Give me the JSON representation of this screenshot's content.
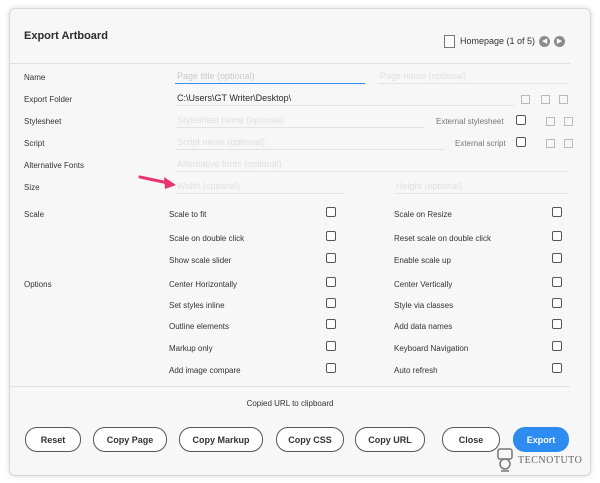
{
  "dialog": {
    "title": "Export Artboard",
    "page_nav": {
      "label": "Homepage (1 of 5)",
      "prev_icon": "chevron-left-icon",
      "next_icon": "chevron-right-icon"
    }
  },
  "fields": {
    "name": {
      "label": "Name",
      "placeholder": "Page title (optional)",
      "secondary_placeholder": "Page name (optional)"
    },
    "export_folder": {
      "label": "Export Folder",
      "value": "C:\\Users\\GT Writer\\Desktop\\"
    },
    "stylesheet": {
      "label": "Stylesheet",
      "placeholder": "Stylesheet name (optional)",
      "option_label": "External stylesheet"
    },
    "script": {
      "label": "Script",
      "placeholder": "Script name (optional)",
      "option_label": "External script"
    },
    "alt_fonts": {
      "label": "Alternative Fonts",
      "placeholder": "Alternative fonts (optional)"
    },
    "size": {
      "label": "Size",
      "width_placeholder": "Width (optional)",
      "height_placeholder": "Height (optional)"
    }
  },
  "scale": {
    "label": "Scale",
    "left": [
      "Scale to fit",
      "Scale on double click",
      "Show scale slider"
    ],
    "right": [
      "Scale on Resize",
      "Reset scale on double click",
      "Enable scale up"
    ]
  },
  "options": {
    "label": "Options",
    "left": [
      "Center Horizontally",
      "Set styles inline",
      "Outline elements",
      "Markup only",
      "Add image compare"
    ],
    "right": [
      "Center Vertically",
      "Style via classes",
      "Add data names",
      "Keyboard Navigation",
      "Auto refresh"
    ]
  },
  "status": "Copied URL to clipboard",
  "buttons": {
    "reset": "Reset",
    "copy_page": "Copy Page",
    "copy_markup": "Copy Markup",
    "copy_css": "Copy CSS",
    "copy_url": "Copy URL",
    "close": "Close",
    "export": "Export"
  },
  "watermark": {
    "text": "TECNOTUTO"
  },
  "colors": {
    "accent": "#2e8bf0",
    "arrow": "#e8336d",
    "background": "#f7f7f7"
  }
}
